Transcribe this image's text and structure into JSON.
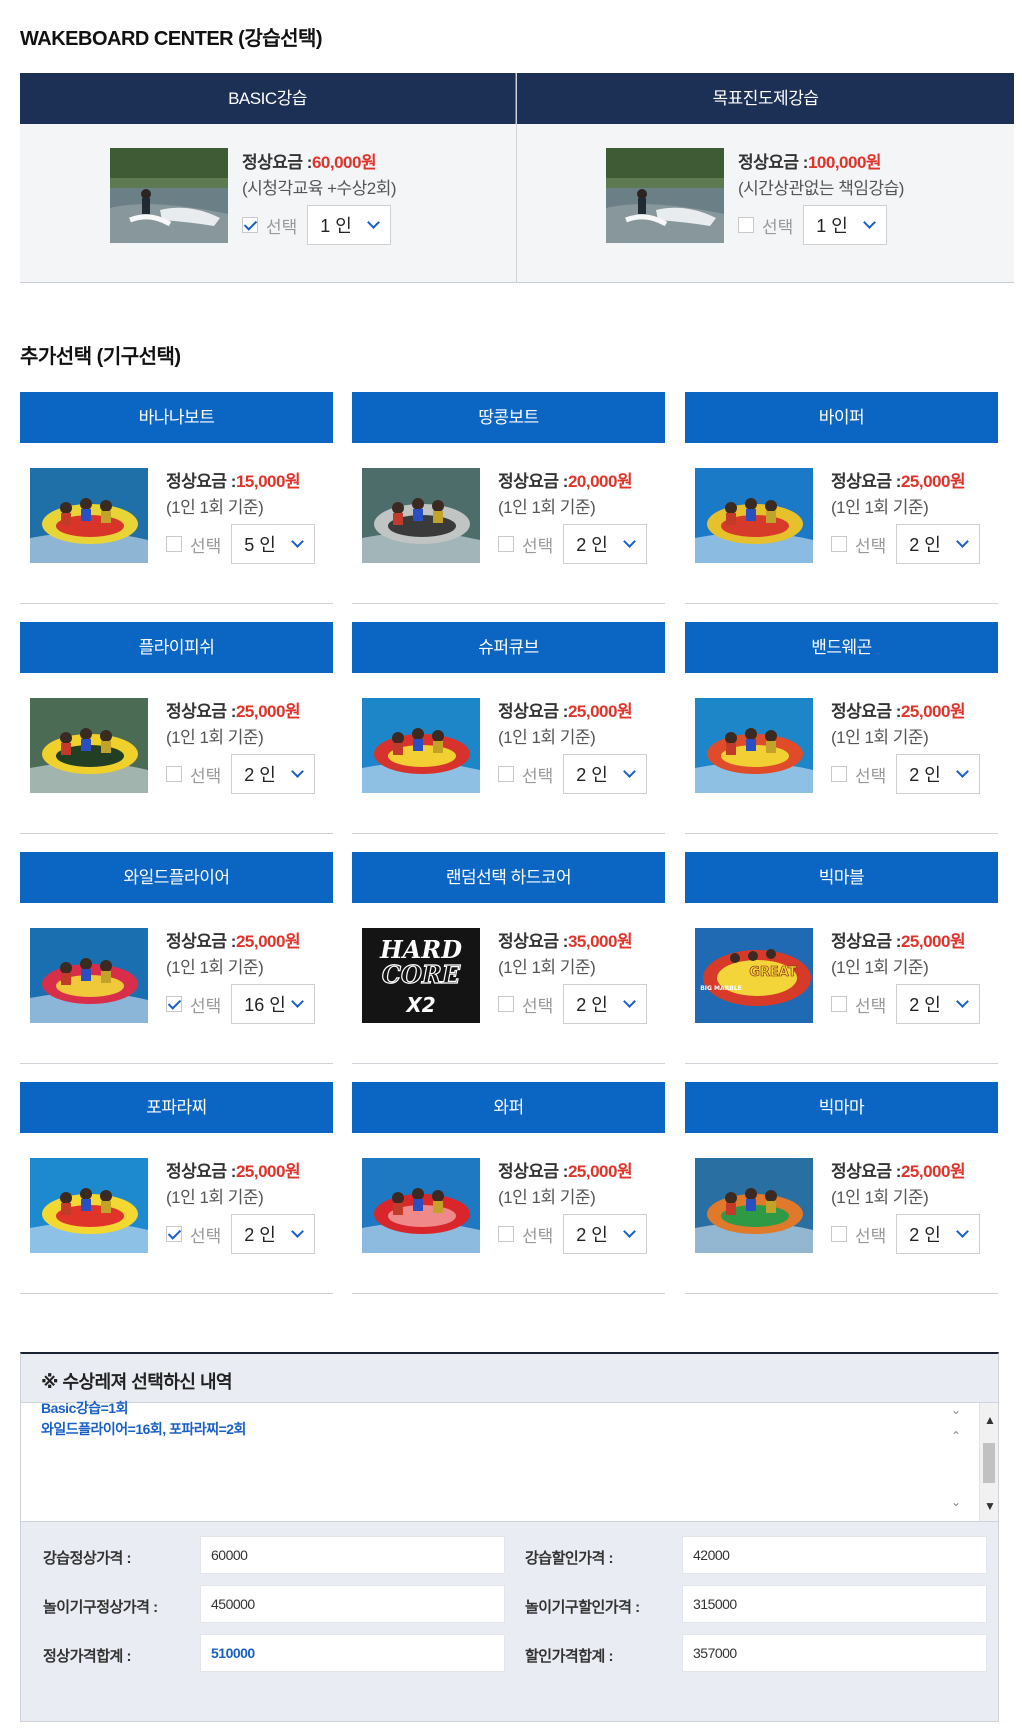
{
  "lesson_section": {
    "title": "WAKEBOARD CENTER (강습선택)",
    "items": [
      {
        "name": "BASIC강습",
        "price_label": "정상요금 :",
        "price": "60,000원",
        "note": "(시청각교육 +수상2회)",
        "check_label": "선택",
        "checked": true,
        "qty": "1 인"
      },
      {
        "name": "목표진도제강습",
        "price_label": "정상요금 :",
        "price": "100,000원",
        "note": "(시간상관없는 책임강습)",
        "check_label": "선택",
        "checked": false,
        "qty": "1 인"
      }
    ]
  },
  "equipment_section": {
    "title": "추가선택 (기구선택)",
    "items": [
      {
        "name": "바나나보트",
        "price_label": "정상요금 :",
        "price": "15,000원",
        "note": "(1인 1회 기준)",
        "check_label": "선택",
        "checked": false,
        "qty": "5 인"
      },
      {
        "name": "땅콩보트",
        "price_label": "정상요금 :",
        "price": "20,000원",
        "note": "(1인 1회 기준)",
        "check_label": "선택",
        "checked": false,
        "qty": "2 인"
      },
      {
        "name": "바이퍼",
        "price_label": "정상요금 :",
        "price": "25,000원",
        "note": "(1인 1회 기준)",
        "check_label": "선택",
        "checked": false,
        "qty": "2 인"
      },
      {
        "name": "플라이피쉬",
        "price_label": "정상요금 :",
        "price": "25,000원",
        "note": "(1인 1회 기준)",
        "check_label": "선택",
        "checked": false,
        "qty": "2 인"
      },
      {
        "name": "슈퍼큐브",
        "price_label": "정상요금 :",
        "price": "25,000원",
        "note": "(1인 1회 기준)",
        "check_label": "선택",
        "checked": false,
        "qty": "2 인"
      },
      {
        "name": "밴드웨곤",
        "price_label": "정상요금 :",
        "price": "25,000원",
        "note": "(1인 1회 기준)",
        "check_label": "선택",
        "checked": false,
        "qty": "2 인"
      },
      {
        "name": "와일드플라이어",
        "price_label": "정상요금 :",
        "price": "25,000원",
        "note": "(1인 1회 기준)",
        "check_label": "선택",
        "checked": true,
        "qty": "16 인"
      },
      {
        "name": "랜덤선택 하드코어",
        "price_label": "정상요금 :",
        "price": "35,000원",
        "note": "(1인 1회 기준)",
        "check_label": "선택",
        "checked": false,
        "qty": "2 인",
        "thumb_text": [
          "HARD",
          "CORE",
          "X2"
        ]
      },
      {
        "name": "빅마블",
        "price_label": "정상요금 :",
        "price": "25,000원",
        "note": "(1인 1회 기준)",
        "check_label": "선택",
        "checked": false,
        "qty": "2 인",
        "thumb_text": [
          "GREAT",
          "BIG MARBLE"
        ]
      },
      {
        "name": "포파라찌",
        "price_label": "정상요금 :",
        "price": "25,000원",
        "note": "(1인 1회 기준)",
        "check_label": "선택",
        "checked": true,
        "qty": "2 인"
      },
      {
        "name": "와퍼",
        "price_label": "정상요금 :",
        "price": "25,000원",
        "note": "(1인 1회 기준)",
        "check_label": "선택",
        "checked": false,
        "qty": "2 인"
      },
      {
        "name": "빅마마",
        "price_label": "정상요금 :",
        "price": "25,000원",
        "note": "(1인 1회 기준)",
        "check_label": "선택",
        "checked": false,
        "qty": "2 인"
      }
    ]
  },
  "summary": {
    "title": "※ 수상레져 선택하신 내역",
    "lines": [
      "Basic강습=1회",
      "와일드플라이어=16회, 포파라찌=2회"
    ],
    "fields": {
      "lesson_regular": {
        "label": "강습정상가격 :",
        "value": "60000"
      },
      "lesson_discount": {
        "label": "강습할인가격 :",
        "value": "42000"
      },
      "equip_regular": {
        "label": "놀이기구정상가격 :",
        "value": "450000"
      },
      "equip_discount": {
        "label": "놀이기구할인가격 :",
        "value": "315000"
      },
      "total_regular": {
        "label": "정상가격합계 :",
        "value": "510000"
      },
      "total_discount": {
        "label": "할인가격합계 :",
        "value": "357000"
      }
    }
  },
  "colors": {
    "lesson_header": "#1c2f55",
    "equip_header": "#0b66c3",
    "price_accent": "#e0342b",
    "link_blue": "#1a5fc7"
  }
}
